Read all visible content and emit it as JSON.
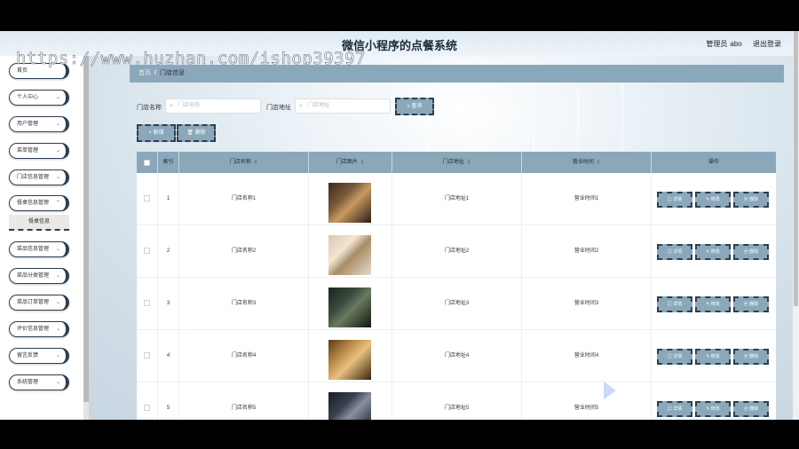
{
  "app": {
    "title": "微信小程序的点餐系统",
    "user_role": "管理员",
    "username": "abo",
    "logout": "退出登录"
  },
  "watermark": "https://www.huzhan.com/ishop39397",
  "sidebar": {
    "items": [
      {
        "label": "首页"
      },
      {
        "label": "个人中心"
      },
      {
        "label": "用户管理"
      },
      {
        "label": "菜单管理"
      },
      {
        "label": "门店信息管理"
      },
      {
        "label": "餐桌信息管理"
      },
      {
        "label": "菜品信息管理"
      },
      {
        "label": "菜品分类管理"
      },
      {
        "label": "菜品订单管理"
      },
      {
        "label": "评价信息管理"
      },
      {
        "label": "留言反馈"
      },
      {
        "label": "系统管理"
      }
    ],
    "sub_item": "餐桌信息"
  },
  "breadcrumb": {
    "home": "首页",
    "separator": "/",
    "current": "门店信息"
  },
  "search": {
    "name_label": "门店名称",
    "name_placeholder": "门店名称",
    "addr_label": "门店地址",
    "addr_placeholder": "门店地址",
    "query_button": "查询"
  },
  "actions": {
    "add": "新增",
    "delete": "删除"
  },
  "table": {
    "headers": {
      "index": "索引",
      "name": "门店名称",
      "image": "门店图片",
      "address": "门店地址",
      "hours": "营业时间",
      "ops": "操作"
    },
    "op_labels": {
      "detail": "详情",
      "edit": "修改",
      "delete": "删除"
    },
    "rows": [
      {
        "index": "1",
        "name": "门店名称1",
        "address": "门店地址1",
        "hours": "营业时间1"
      },
      {
        "index": "2",
        "name": "门店名称2",
        "address": "门店地址2",
        "hours": "营业时间2"
      },
      {
        "index": "3",
        "name": "门店名称3",
        "address": "门店地址3",
        "hours": "营业时间3"
      },
      {
        "index": "4",
        "name": "门店名称4",
        "address": "门店地址4",
        "hours": "营业时间4"
      },
      {
        "index": "5",
        "name": "门店名称5",
        "address": "门店地址5",
        "hours": "营业时间5"
      }
    ]
  },
  "colors": {
    "accent": "#8aa8ba",
    "dark": "#2c3e50"
  }
}
